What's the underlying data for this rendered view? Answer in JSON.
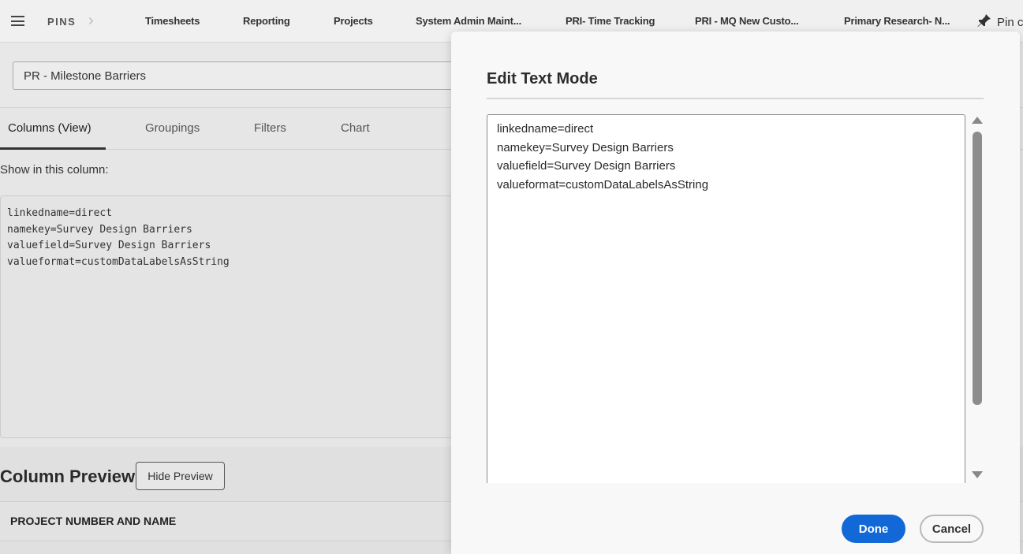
{
  "topbar": {
    "pins_label": "PINS",
    "pins": [
      "Timesheets",
      "Reporting",
      "Projects",
      "System Admin Maint...",
      "PRI- Time Tracking",
      "PRI - MQ New Custo...",
      "Primary Research- N..."
    ],
    "pin_action": "Pin c"
  },
  "report": {
    "name": "PR - Milestone Barriers"
  },
  "tabs": [
    "Columns (View)",
    "Groupings",
    "Filters",
    "Chart"
  ],
  "column_editor": {
    "label": "Show in this column:",
    "lines": [
      "linkedname=direct",
      "namekey=Survey Design Barriers",
      "valuefield=Survey Design Barriers",
      "valueformat=customDataLabelsAsString"
    ]
  },
  "preview": {
    "title": "Column Preview",
    "hide_button": "Hide Preview",
    "header": "PROJECT NUMBER AND NAME"
  },
  "dialog": {
    "title": "Edit Text Mode",
    "lines": [
      "linkedname=direct",
      "namekey=Survey Design Barriers",
      "valuefield=Survey Design Barriers",
      "valueformat=customDataLabelsAsString"
    ],
    "done_label": "Done",
    "cancel_label": "Cancel"
  },
  "colors": {
    "accent": "#1268d6",
    "overlay_bg": "#e6e6e6",
    "dialog_bg": "#f8f8f8"
  }
}
